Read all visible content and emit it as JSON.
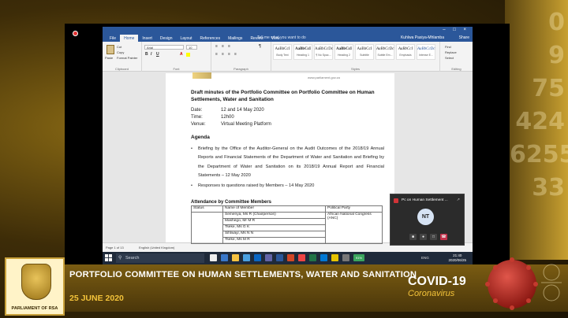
{
  "colors": {
    "word_blue": "#2b579a",
    "gold": "#f3c33a",
    "band": "#5a420c"
  },
  "word": {
    "tabs": [
      "File",
      "Home",
      "Insert",
      "Design",
      "Layout",
      "References",
      "Mailings",
      "Review",
      "View"
    ],
    "active_tab": "Home",
    "tell_me": "Tell me what you want to do",
    "user": "Kuhlwa Pasiya-Mhlamba",
    "share": "Share",
    "ribbon": {
      "clipboard": {
        "paste": "Paste",
        "cut": "Cut",
        "copy": "Copy",
        "format_painter": "Format Painter",
        "label": "Clipboard"
      },
      "font": {
        "name": "Arial",
        "size": "10",
        "label": "Font"
      },
      "paragraph": {
        "label": "Paragraph"
      },
      "styles": {
        "label": "Styles",
        "items": [
          {
            "sample": "AaBbCcI",
            "name": "Body Text"
          },
          {
            "sample": "AaBbCcI",
            "name": "Heading 1"
          },
          {
            "sample": "AaBbCcDc",
            "name": "¶ No Spac..."
          },
          {
            "sample": "AaBbCcI",
            "name": "Heading 2"
          },
          {
            "sample": "AaBbCcI",
            "name": "Subtitle"
          },
          {
            "sample": "AaBbCcDc",
            "name": "Subtle Em..."
          },
          {
            "sample": "AaBbCcI",
            "name": "Emphasis"
          },
          {
            "sample": "AaBbCcDc",
            "name": "Intense E..."
          }
        ]
      },
      "editing": {
        "find": "Find",
        "replace": "Replace",
        "select": "Select",
        "label": "Editing"
      }
    },
    "header_url": "www.parliament.gov.za",
    "doc": {
      "title": "Draft minutes of the Portfolio Committee on Portfolio Committee on Human Settlements, Water and Sanitation",
      "date_label": "Date:",
      "date": "12 and 14 May 2020",
      "time_label": "Time:",
      "time": "12h00",
      "venue_label": "Venue:",
      "venue": "Virtual Meeting Platform",
      "agenda": "Agenda",
      "bullets": [
        "Briefing by the Office of the Auditor-General on the Audit Outcomes of the 2018/19 Annual Reports and Financial Statements of the Department of Water and Sanitation and Briefing by the Department of Water and Sanitation on its 2018/19 Annual Report and Financial Statements – 12 May 2020",
        "Responses to questions raised by Members – 14 May 2020"
      ],
      "attendance": "Attendance by Committee Members",
      "table_headers": [
        "Status",
        "Name of Member",
        "Political Party"
      ],
      "members": [
        "Semenya, Ms R (Chairperson)",
        "Mashego, Mr M R",
        "Tseke, Ms G K",
        "Sihlwayi, Ms N N",
        "Tseke, Ms M R"
      ],
      "party": "African National Congress (ANC)"
    },
    "status": {
      "page": "Page 1 of 13",
      "language": "English (United Kingdom)"
    }
  },
  "taskbar": {
    "search": "Search",
    "zoom": "91%",
    "lang": "ENG",
    "time": "21:40",
    "date": "2020/06/25"
  },
  "meeting": {
    "title": "Pc on Human Settlement ...",
    "initials": "NT"
  },
  "broadcast": {
    "committee": "PORTFOLIO COMMITTEE ON HUMAN SETTLEMENTS, WATER AND SANITATION",
    "date": "25 JUNE 2020",
    "logo_text": "PARLIAMENT OF RSA",
    "covid": "COVID-19",
    "coronavirus": "Coronavirus",
    "bg_digits": [
      "0",
      "9",
      "75",
      "424",
      "6255",
      "33"
    ]
  }
}
